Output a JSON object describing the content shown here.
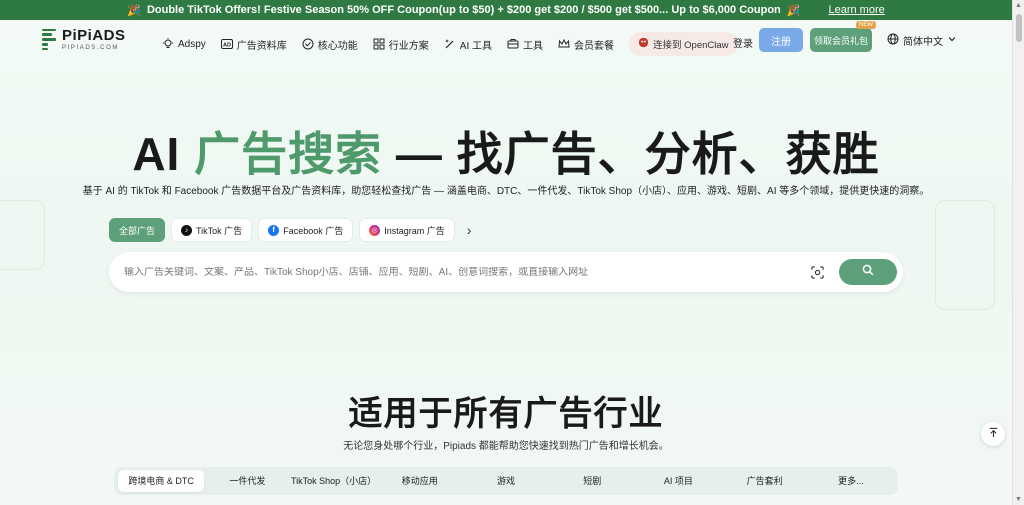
{
  "banner": {
    "emoji_left": "🎉",
    "text": "Double TikTok Offers! Festive Season 50% OFF Coupon(up to $50) + $200 get $200 / $500 get $500... Up to $6,000 Coupon",
    "emoji_right": "🎉",
    "learn_more": "Learn more"
  },
  "brand": {
    "name": "PiPiADS",
    "domain": "PIPIADS.COM",
    "accent": "#2f7a43"
  },
  "nav": {
    "items": [
      {
        "label": "Adspy",
        "icon": "bulb-icon"
      },
      {
        "label": "广告资料库",
        "icon": "ad-library-icon"
      },
      {
        "label": "核心功能",
        "icon": "check-circle-icon"
      },
      {
        "label": "行业方案",
        "icon": "grid-icon"
      },
      {
        "label": "AI 工具",
        "icon": "magic-wand-icon"
      },
      {
        "label": "工具",
        "icon": "toolbox-icon"
      },
      {
        "label": "会员套餐",
        "icon": "crown-icon"
      }
    ],
    "openclaw": {
      "label": "连接到 OpenClaw",
      "icon": "claw-icon"
    },
    "login": "登录",
    "signup": "注册",
    "gift": {
      "label": "领取会员礼包",
      "badge": "NEW"
    },
    "language": "简体中文"
  },
  "hero": {
    "title_prefix": "AI ",
    "title_highlight": "广告搜索",
    "title_rest": " — 找广告、分析、获胜",
    "subtitle": "基于 AI 的 TikTok 和 Facebook 广告数据平台及广告资料库，助您轻松查找广告 — 涵盖电商、DTC、一件代发、TikTok Shop（小店）、应用、游戏、短剧、AI 等多个领域，提供更快速的洞察。"
  },
  "filters": [
    {
      "label": "全部广告",
      "active": true
    },
    {
      "label": "TikTok 广告",
      "icon": "tiktok-icon",
      "active": false
    },
    {
      "label": "Facebook 广告",
      "icon": "facebook-icon",
      "active": false
    },
    {
      "label": "Instagram 广告",
      "icon": "instagram-icon",
      "active": false
    }
  ],
  "search": {
    "placeholder": "输入广告关键词、文案、产品、TikTok Shop小店、店铺、应用、短剧、AI、创意词搜索，或直接输入网址",
    "value": ""
  },
  "industries": {
    "title": "适用于所有广告行业",
    "subtitle": "无论您身处哪个行业，Pipiads 都能帮助您快速找到热门广告和增长机会。",
    "tabs": [
      {
        "label": "跨境电商 & DTC",
        "active": true
      },
      {
        "label": "一件代发",
        "active": false
      },
      {
        "label": "TikTok Shop（小店）",
        "active": false
      },
      {
        "label": "移动应用",
        "active": false
      },
      {
        "label": "游戏",
        "active": false
      },
      {
        "label": "短剧",
        "active": false
      },
      {
        "label": "AI 项目",
        "active": false
      },
      {
        "label": "广告套利",
        "active": false
      },
      {
        "label": "更多...",
        "active": false
      }
    ]
  }
}
